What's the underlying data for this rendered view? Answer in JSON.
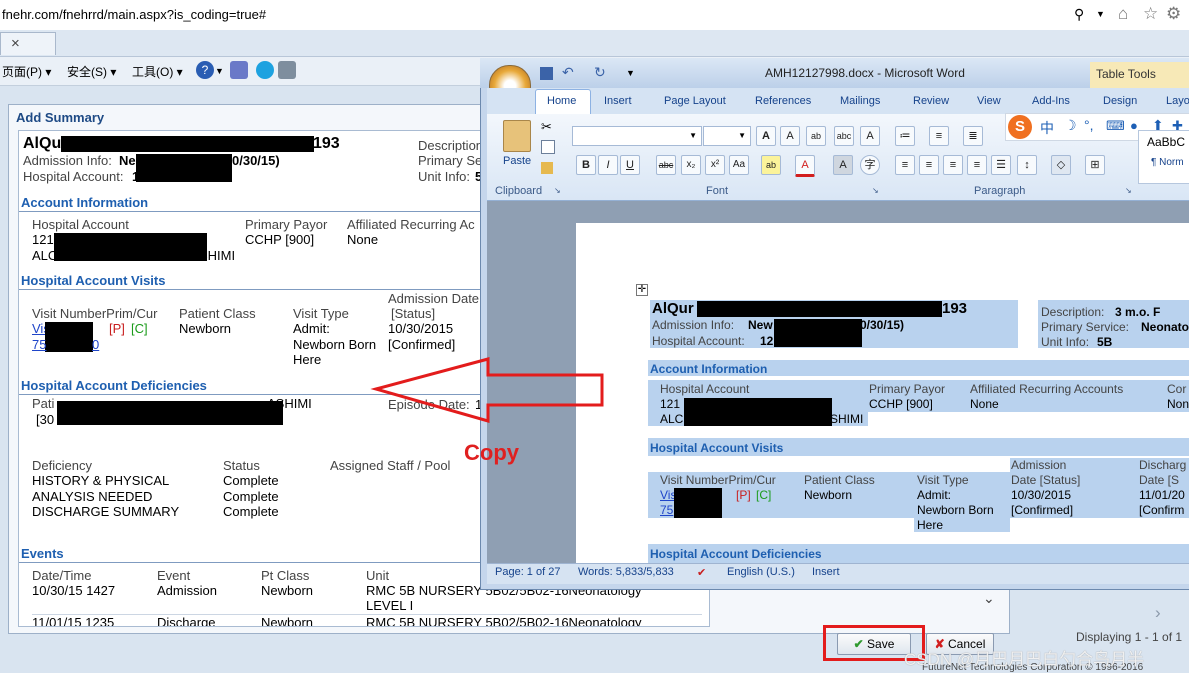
{
  "browser": {
    "url": "fnehr.com/fnehrrd/main.aspx?is_coding=true#",
    "tab_close": "×",
    "menu": [
      "页面(P) ▾",
      "安全(S) ▾",
      "工具(O) ▾",
      "? ▾"
    ]
  },
  "dialog": {
    "title": "Add Summary",
    "header": {
      "patient_name": "AlQu",
      "patient_id_tail": "193",
      "admission_label": "Admission Info:",
      "admission_value_start": "Ne",
      "admission_value_end": "0/30/15)",
      "hospital_account_label": "Hospital Account:",
      "hospital_account_value": "1",
      "description_label": "Description",
      "primary_service_label": "Primary Se",
      "unit_info_label": "Unit Info:",
      "unit_info_value": "5"
    },
    "account_info": {
      "heading": "Account Information",
      "col_hospital_account": "Hospital Account",
      "col_primary_payor": "Primary Payor",
      "col_affiliated": "Affiliated Recurring Ac",
      "account_num": "121",
      "account_name_start": "ALC",
      "account_name_end": "SHIMI",
      "payor": "CCHP [900]",
      "affiliated": "None"
    },
    "visits": {
      "heading": "Hospital Account Visits",
      "col_visit": "Visit NumberPrim/Cur",
      "col_class": "Patient Class",
      "col_type": "Visit Type",
      "col_admission": "Admission Date",
      "col_status": "[Status]",
      "visit_link1": "Vis",
      "visit_link2": "75",
      "visit_link2_end": "0",
      "flag_p": "[P]",
      "flag_c": "[C]",
      "patient_class": "Newborn",
      "visit_type_1": "Admit:",
      "visit_type_2": "Newborn Born",
      "visit_type_3": "Here",
      "admission_date": "10/30/2015",
      "admission_status": "[Confirmed]"
    },
    "deficiencies": {
      "heading": "Hospital Account Deficiencies",
      "patient_label": "Pati",
      "patient_value_end": "ASHIMI",
      "bracket_start": "[30",
      "episode_label": "Episode Date:",
      "episode_value": "1",
      "col_deficiency": "Deficiency",
      "col_status": "Status",
      "col_staff": "Assigned Staff / Pool",
      "rows": [
        {
          "deficiency": "HISTORY & PHYSICAL",
          "status": "Complete"
        },
        {
          "deficiency": "ANALYSIS NEEDED",
          "status": "Complete"
        },
        {
          "deficiency": "DISCHARGE SUMMARY",
          "status": "Complete"
        }
      ]
    },
    "events": {
      "heading": "Events",
      "col_datetime": "Date/Time",
      "col_event": "Event",
      "col_ptclass": "Pt Class",
      "col_unit": "Unit",
      "rows": [
        {
          "datetime": "10/30/15 1427",
          "event": "Admission",
          "ptclass": "Newborn",
          "unit": "RMC 5B NURSERY 5B02/5B02-16Neonatology",
          "unit2": "LEVEL I"
        },
        {
          "datetime": "11/01/15 1235",
          "event": "Discharge",
          "ptclass": "Newborn",
          "unit": "RMC 5B NURSERY 5B02/5B02-16Neonatology",
          "unit2": ""
        }
      ]
    },
    "save_label": "Save",
    "cancel_label": "Cancel",
    "displaying": "Displaying 1 - 1 of 1",
    "copyright": "FutureNet Technologies Corporation © 1996-2016"
  },
  "annotation": {
    "copy_label": "Copy"
  },
  "word": {
    "window_title": "AMH12127998.docx - Microsoft Word",
    "table_tools": "Table Tools",
    "tabs": [
      "Home",
      "Insert",
      "Page Layout",
      "References",
      "Mailings",
      "Review",
      "View",
      "Add-Ins",
      "Design",
      "Layo"
    ],
    "group_clipboard": "Clipboard",
    "group_font": "Font",
    "group_paragraph": "Paragraph",
    "paste_label": "Paste",
    "style_preview": "AaBbC",
    "style_normal": "¶ Norm",
    "doc": {
      "name_start": "AlQur",
      "name_end": "193",
      "admission_label": "Admission Info:",
      "admission_value_start": "New",
      "admission_value_end": "0/30/15)",
      "hospital_account_label": "Hospital Account:",
      "hospital_account_value": "12",
      "description_label": "Description:",
      "description_value": "3 m.o. F",
      "primary_service_label": "Primary Service:",
      "primary_service_value": "Neonato",
      "unit_info_label": "Unit Info:",
      "unit_info_value": "5B",
      "account_heading": "Account Information",
      "col_hospital_account": "Hospital Account",
      "col_primary_payor": "Primary Payor",
      "col_affiliated": "Affiliated Recurring Accounts",
      "col_cor": "Cor",
      "account_num": "121",
      "account_name_start": "ALC",
      "account_name_end": "SHIMI",
      "payor": "CCHP [900]",
      "affiliated": "None",
      "affiliated2": "Non",
      "visits_heading": "Hospital Account Visits",
      "col_visit": "Visit NumberPrim/Cur",
      "col_class": "Patient Class",
      "col_type": "Visit Type",
      "col_admission_1": "Admission",
      "col_admission_2": "Date [Status]",
      "col_discharge_1": "Discharg",
      "col_discharge_2": "Date [S",
      "visit_link1": "Vis",
      "visit_link2": "75",
      "flag_p": "[P]",
      "flag_c": "[C]",
      "patient_class": "Newborn",
      "visit_type_1": "Admit:",
      "visit_type_2": "Newborn Born",
      "visit_type_3": "Here",
      "admission_date": "10/30/2015",
      "admission_status": "[Confirmed]",
      "discharge_date": "11/01/20",
      "discharge_status": "[Confirm",
      "deficiencies_heading": "Hospital Account Deficiencies"
    },
    "status": {
      "page": "Page: 1 of 27",
      "words": "Words: 5,833/5,833",
      "language": "English (U.S.)",
      "mode": "Insert"
    }
  },
  "watermark": "CSDN @月巴月巴白勺合鸟月半",
  "colors": {
    "accent": "#1e5fb0",
    "annotation_red": "#e31c1c"
  }
}
